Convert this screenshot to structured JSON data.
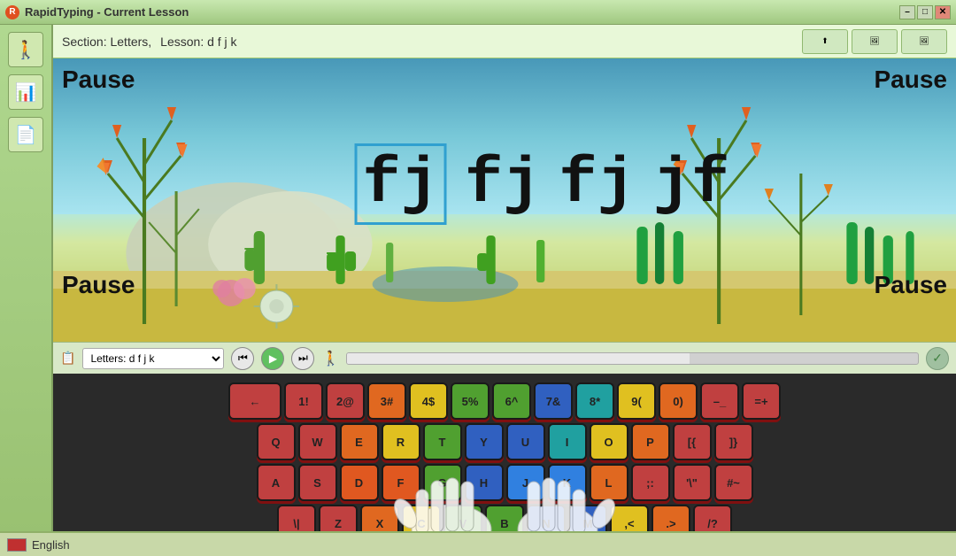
{
  "titleBar": {
    "title": "RapidTyping - Current Lesson",
    "minLabel": "–",
    "maxLabel": "□",
    "closeLabel": "✕"
  },
  "toolbar": {
    "sectionLabel": "Section: Letters,",
    "lessonLabel": "Lesson: d f j k",
    "btn1": "↗↗",
    "btn2": "🖼",
    "btn3": "🖼"
  },
  "scene": {
    "pauseTopLeft": "Pause",
    "pauseTopRight": "Pause",
    "pauseBottomLeft": "Pause",
    "pauseBottomRight": "Pause",
    "words": [
      "fj",
      "fj",
      "fj",
      "jf"
    ],
    "highlightIndex": 1
  },
  "controls": {
    "lessonName": "Letters: d f j k",
    "prevLabel": "⏮",
    "playLabel": "▶",
    "nextLabel": "⏭",
    "walkerIcon": "🚶"
  },
  "keyboard": {
    "row0": [
      {
        "label": "←",
        "color": "num"
      },
      {
        "label": "1!",
        "color": "num"
      },
      {
        "label": "2@",
        "color": "num"
      },
      {
        "label": "3#",
        "color": "lt-orange"
      },
      {
        "label": "4$",
        "color": "lt-yellow"
      },
      {
        "label": "5%",
        "color": "lt-green"
      },
      {
        "label": "6^",
        "color": "lt-green"
      },
      {
        "label": "7&",
        "color": "lt-blue"
      },
      {
        "label": "8*",
        "color": "lt-teal"
      },
      {
        "label": "9(",
        "color": "lt-yellow"
      },
      {
        "label": "0)",
        "color": "lt-orange"
      },
      {
        "label": "–_",
        "color": "num"
      },
      {
        "label": "=+",
        "color": "num"
      }
    ],
    "row1": [
      {
        "label": "Q",
        "color": "num"
      },
      {
        "label": "W",
        "color": "num"
      },
      {
        "label": "E",
        "color": "lt-orange"
      },
      {
        "label": "R",
        "color": "lt-yellow"
      },
      {
        "label": "T",
        "color": "lt-green"
      },
      {
        "label": "Y",
        "color": "lt-blue"
      },
      {
        "label": "U",
        "color": "lt-blue"
      },
      {
        "label": "I",
        "color": "lt-teal"
      },
      {
        "label": "O",
        "color": "lt-yellow"
      },
      {
        "label": "P",
        "color": "lt-orange"
      },
      {
        "label": "[{",
        "color": "num"
      },
      {
        "label": "]}",
        "color": "num"
      }
    ],
    "row2": [
      {
        "label": "A",
        "color": "num"
      },
      {
        "label": "S",
        "color": "num"
      },
      {
        "label": "D",
        "color": "home-left"
      },
      {
        "label": "F",
        "color": "home-left"
      },
      {
        "label": "G",
        "color": "lt-green"
      },
      {
        "label": "H",
        "color": "lt-blue"
      },
      {
        "label": "J",
        "color": "home-right"
      },
      {
        "label": "K",
        "color": "home-right"
      },
      {
        "label": "L",
        "color": "lt-orange"
      },
      {
        "label": ";:",
        "color": "num"
      },
      {
        "label": "'\"",
        "color": "num"
      },
      {
        "label": "#~",
        "color": "num"
      }
    ],
    "row3": [
      {
        "label": "\\|",
        "color": "num"
      },
      {
        "label": "Z",
        "color": "num"
      },
      {
        "label": "X",
        "color": "lt-orange"
      },
      {
        "label": "C",
        "color": "lt-yellow"
      },
      {
        "label": "V",
        "color": "lt-green"
      },
      {
        "label": "B",
        "color": "lt-green"
      },
      {
        "label": "N",
        "color": "lt-blue"
      },
      {
        "label": "M",
        "color": "lt-blue"
      },
      {
        "label": ",<",
        "color": "lt-yellow"
      },
      {
        "label": ".>",
        "color": "lt-orange"
      },
      {
        "label": "/?",
        "color": "num"
      }
    ]
  },
  "statusBar": {
    "language": "English"
  }
}
